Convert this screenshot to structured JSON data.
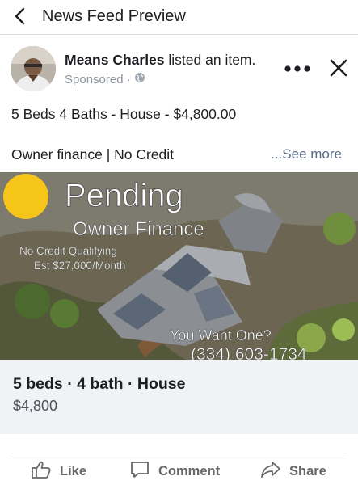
{
  "topbar": {
    "title": "News Feed Preview"
  },
  "post": {
    "author": "Means Charles",
    "action": "listed an item.",
    "sponsored_label": "Sponsored · ",
    "line1": "5 Beds 4 Baths - House - $4,800.00",
    "line2": "Owner finance | No Credit",
    "see_more": "...See more"
  },
  "photo_overlay": {
    "pending": "Pending",
    "owner_finance": "Owner Finance",
    "no_credit": "No Credit Qualifying",
    "est": "Est $27,000/Month",
    "you_want": "You Want One?",
    "phone": "(334) 603-1734"
  },
  "listing": {
    "summary": "5 beds · 4 bath · House",
    "price": "$4,800"
  },
  "actions": {
    "like": "Like",
    "comment": "Comment",
    "share": "Share"
  },
  "icons": [
    "back-arrow-icon",
    "globe-icon",
    "more-icon",
    "close-icon",
    "like-icon",
    "comment-icon",
    "share-icon"
  ],
  "colors": {
    "link": "#5a6b86",
    "muted": "#65676b",
    "caption_bg": "#f0f2f5",
    "sun": "#f5c518"
  }
}
